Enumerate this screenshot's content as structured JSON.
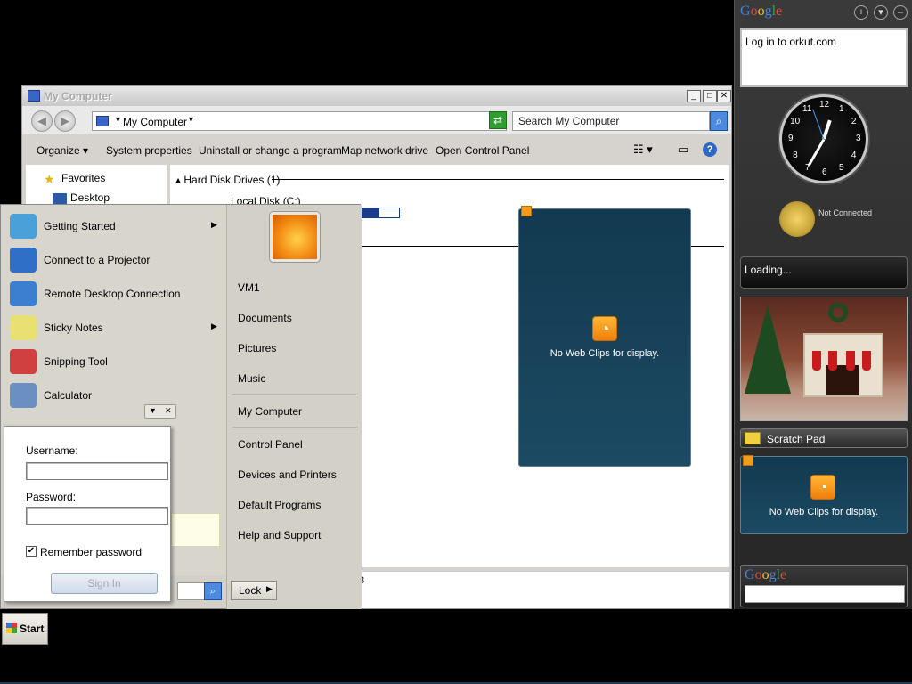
{
  "explorer": {
    "title": "My Computer",
    "address": "My Computer",
    "search_placeholder": "Search My Computer",
    "commands": [
      "Organize",
      "System properties",
      "Uninstall or change a program",
      "Map network drive",
      "Open Control Panel"
    ],
    "nav": {
      "favorites": "Favorites",
      "desktop": "Desktop"
    },
    "group": "Hard Disk Drives (1)",
    "disk": {
      "name": "Local Disk (C:)",
      "used_fraction": 0.6
    },
    "details_num": "8"
  },
  "webclips_large": {
    "message": "No Web Clips for display."
  },
  "start_menu": {
    "programs": [
      {
        "label": "Getting Started",
        "has_arrow": true,
        "icon": "getting-started-icon",
        "color": "#4aa0d8"
      },
      {
        "label": "Connect to a Projector",
        "has_arrow": false,
        "icon": "projector-icon",
        "color": "#2f6fc8"
      },
      {
        "label": "Remote Desktop Connection",
        "has_arrow": false,
        "icon": "remote-desktop-icon",
        "color": "#3a7fd0"
      },
      {
        "label": "Sticky Notes",
        "has_arrow": true,
        "icon": "sticky-notes-icon",
        "color": "#e8e070"
      },
      {
        "label": "Snipping Tool",
        "has_arrow": false,
        "icon": "scissors-icon",
        "color": "#d04040"
      },
      {
        "label": "Calculator",
        "has_arrow": false,
        "icon": "calculator-icon",
        "color": "#6a8fc0"
      }
    ],
    "user": "VM1",
    "right": [
      "Documents",
      "Pictures",
      "Music",
      "My Computer",
      "Control Panel",
      "Devices and Printers",
      "Default Programs",
      "Help and Support"
    ],
    "lock": "Lock"
  },
  "login": {
    "username_label": "Username:",
    "password_label": "Password:",
    "remember": "Remember password",
    "remember_checked": true,
    "signin": "Sign In"
  },
  "taskbar": {
    "start": "Start"
  },
  "sidebar": {
    "google": "Google",
    "orkut": "Log in to orkut.com",
    "clock_numbers": [
      "12",
      "1",
      "2",
      "3",
      "4",
      "5",
      "6",
      "7",
      "8",
      "9",
      "10",
      "11"
    ],
    "clock_time": "12:35",
    "not_connected": "Not Connected",
    "loading": "Loading...",
    "scratch": "Scratch Pad",
    "webclips_msg": "No Web Clips for display.",
    "colors": {
      "background": "#2e2e2e",
      "webclip": "#164056",
      "accent": "#f29a1a"
    }
  }
}
